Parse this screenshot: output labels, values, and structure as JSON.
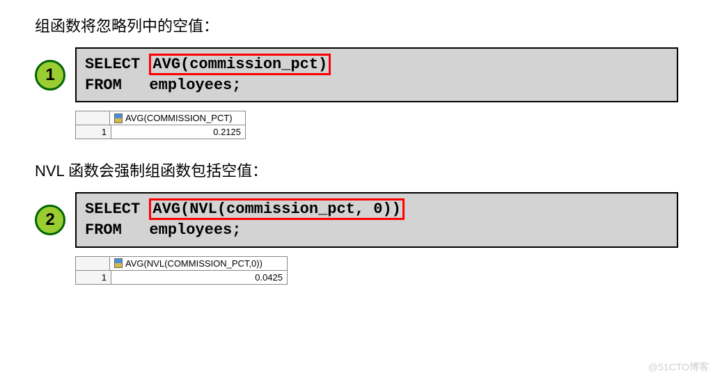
{
  "section1": {
    "heading": "组函数将忽略列中的空值：",
    "badge": "1",
    "code_pre": "SELECT ",
    "code_hl": "AVG(commission_pct)",
    "code_post": "\nFROM   employees;",
    "result_header": "AVG(COMMISSION_PCT)",
    "result_rownum": "1",
    "result_value": "0.2125"
  },
  "section2": {
    "heading": "NVL 函数会强制组函数包括空值：",
    "badge": "2",
    "code_pre": "SELECT ",
    "code_hl": "AVG(NVL(commission_pct, 0))",
    "code_post": "\nFROM   employees;",
    "result_header": "AVG(NVL(COMMISSION_PCT,0))",
    "result_rownum": "1",
    "result_value": "0.0425"
  },
  "watermark": "@51CTO博客"
}
